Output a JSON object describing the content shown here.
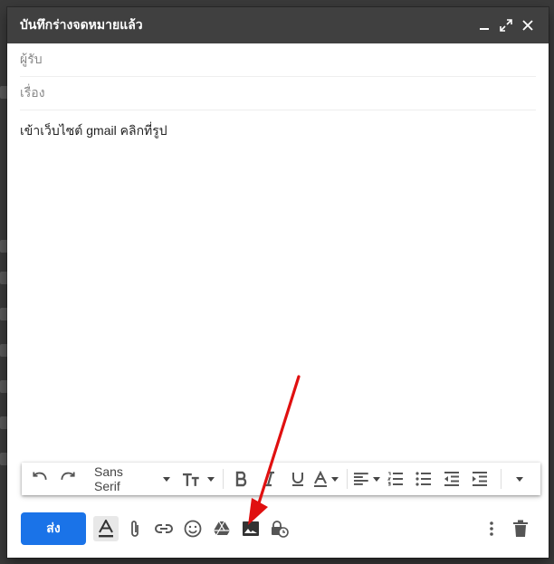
{
  "compose": {
    "title": "บันทึกร่างจดหมายแล้ว",
    "to_placeholder": "ผู้รับ",
    "subject_placeholder": "เรื่อง",
    "body_text": "เข้าเว็บไซต์ gmail คลิกที่รูป"
  },
  "format_toolbar": {
    "font_name": "Sans Serif"
  },
  "bottom_toolbar": {
    "send_label": "ส่ง"
  },
  "colors": {
    "titlebar": "#404040",
    "send_button": "#1a73e8",
    "annotation_arrow": "#e01010"
  }
}
